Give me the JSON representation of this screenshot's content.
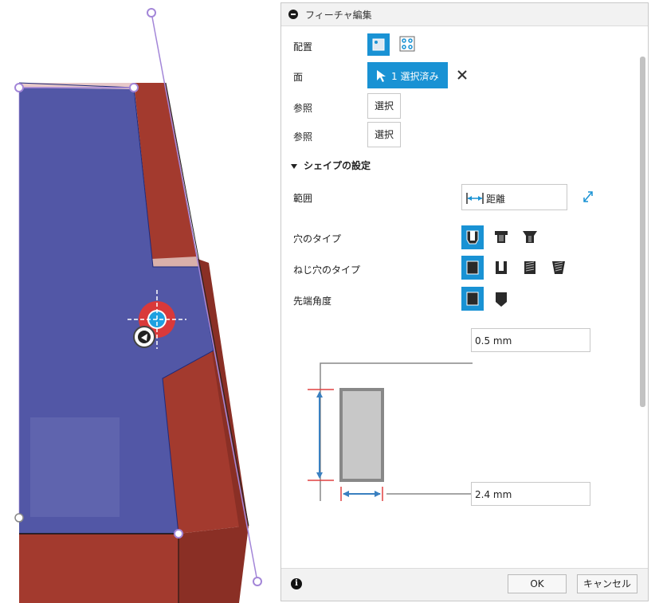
{
  "dialog": {
    "title": "フィーチャ編集",
    "rows": {
      "placement_label": "配置",
      "face_label": "面",
      "face_selected": "1 選択済み",
      "ref1_label": "参照",
      "ref1_button": "選択",
      "ref2_label": "参照",
      "ref2_button": "選択"
    },
    "shape_section": {
      "header": "シェイプの設定",
      "extent_label": "範囲",
      "extent_value": "距離",
      "hole_type_label": "穴のタイプ",
      "tap_type_label": "ねじ穴のタイプ",
      "drill_point_label": "先端角度"
    },
    "dimensions": {
      "depth": "0.5 mm",
      "diameter": "2.4 mm"
    },
    "footer": {
      "ok": "OK",
      "cancel": "キャンセル",
      "info": "i"
    }
  },
  "colors": {
    "accent": "#1992d4",
    "face_blue": "#5257a6",
    "body_red": "#a33a2e",
    "handle_purple": "#a386d8"
  }
}
